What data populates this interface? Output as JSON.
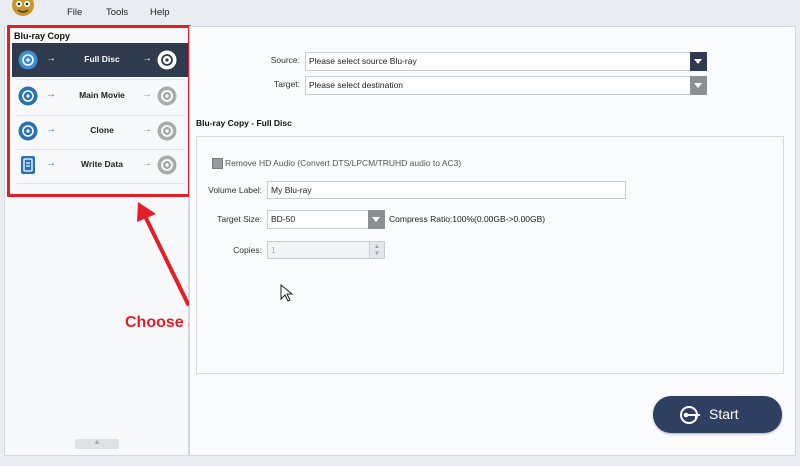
{
  "menu": {
    "file": "File",
    "tools": "Tools",
    "help": "Help"
  },
  "sidebar": {
    "title": "Blu-ray Copy",
    "modes": [
      {
        "label": "Full Disc",
        "icon": "disc-icon",
        "active": true
      },
      {
        "label": "Main Movie",
        "icon": "disc-icon",
        "active": false
      },
      {
        "label": "Clone",
        "icon": "disc-icon",
        "active": false
      },
      {
        "label": "Write Data",
        "icon": "document-icon",
        "active": false
      }
    ],
    "arrow": "→"
  },
  "form": {
    "source_label": "Source:",
    "source_value": "Please select source Blu-ray",
    "target_label": "Target:",
    "target_value": "Please select destination"
  },
  "section": {
    "title": "Blu-ray Copy - Full Disc",
    "remove_hd_audio": "Remove HD Audio (Convert DTS/LPCM/TRUHD audio to AC3)",
    "volume_label_label": "Volume Label:",
    "volume_label_value": "My Blu-ray",
    "target_size_label": "Target Size:",
    "target_size_value": "BD-50",
    "compress_ratio": "Compress Ratio:100%(0.00GB->0.00GB)",
    "copies_label": "Copies:",
    "copies_value": "1"
  },
  "annotation": {
    "text": "Choose a copy mode"
  },
  "start_button": {
    "label": "Start"
  },
  "colors": {
    "accent_dark": "#2f3a4c",
    "annotation_red": "#e41e26",
    "start_blue": "#2f3f62"
  }
}
